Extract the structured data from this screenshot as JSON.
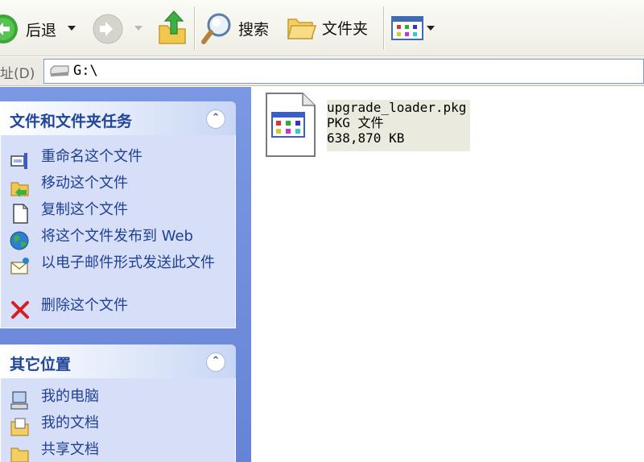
{
  "toolbar": {
    "back_label": "后退",
    "search_label": "搜索",
    "folders_label": "文件夹"
  },
  "address": {
    "label": "址(D)",
    "path": "G:\\"
  },
  "file_tasks": {
    "title": "文件和文件夹任务",
    "collapse_glyph": "⌃",
    "items": [
      {
        "label": "重命名这个文件",
        "icon": "rename-icon"
      },
      {
        "label": "移动这个文件",
        "icon": "move-icon"
      },
      {
        "label": "复制这个文件",
        "icon": "copy-icon"
      },
      {
        "label": "将这个文件发布到 Web",
        "icon": "publish-web-icon"
      },
      {
        "label": "以电子邮件形式发送此文件",
        "icon": "email-icon"
      },
      {
        "label": "删除这个文件",
        "icon": "delete-icon"
      }
    ]
  },
  "other_places": {
    "title": "其它位置",
    "collapse_glyph": "⌃",
    "items": [
      {
        "label": "我的电脑",
        "icon": "my-computer-icon"
      },
      {
        "label": "我的文档",
        "icon": "my-documents-icon"
      },
      {
        "label": "共享文档",
        "icon": "shared-documents-icon"
      }
    ]
  },
  "file": {
    "name": "upgrade_loader.pkg",
    "type": "PKG 文件",
    "size": "638,870 KB"
  },
  "colors": {
    "task_pane": "#7b98e2",
    "panel_body": "#d6dff7",
    "link_text": "#1f3f96",
    "header_text": "#214598"
  }
}
